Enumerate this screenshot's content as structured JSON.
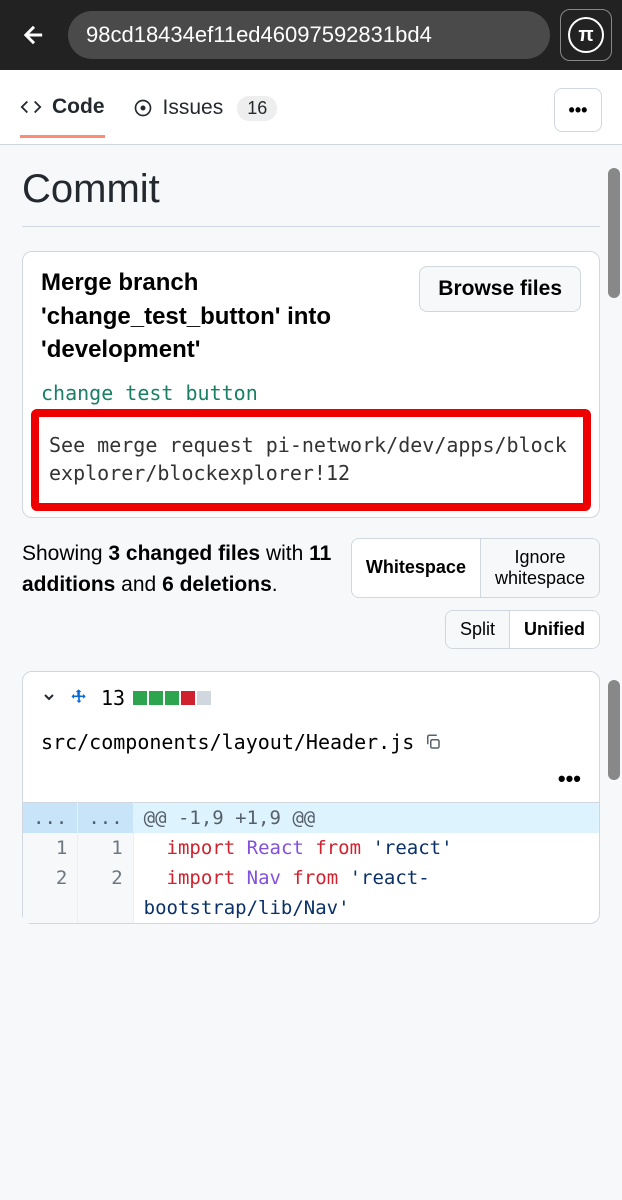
{
  "browser": {
    "url": "98cd18434ef11ed46097592831bd4",
    "pi_symbol": "π"
  },
  "tabs": {
    "code": "Code",
    "issues": "Issues",
    "issues_count": "16"
  },
  "page": {
    "title": "Commit"
  },
  "commit": {
    "title": "Merge branch 'change_test_button' into 'development'",
    "browse_btn": "Browse files",
    "description": "change test button",
    "merge_request": "See merge request pi-network/dev/apps/blockexplorer/blockexplorer!12"
  },
  "summary": {
    "prefix": "Showing ",
    "files": "3 changed files",
    "mid": " with ",
    "additions": "11 additions",
    "and": " and ",
    "deletions": "6 deletions",
    "suffix": "."
  },
  "controls": {
    "whitespace": "Whitespace",
    "ignore_whitespace": "Ignore whitespace",
    "split": "Split",
    "unified": "Unified"
  },
  "file": {
    "stat": "13",
    "path": "src/components/layout/Header.js",
    "hunk": "@@ -1,9 +1,9 @@",
    "ellipsis": "...",
    "rows": [
      {
        "ln_old": "1",
        "ln_new": "1",
        "kw": "import",
        "nm": " React ",
        "from": "from ",
        "str": "'react'"
      },
      {
        "ln_old": "2",
        "ln_new": "2",
        "kw": "import",
        "nm": " Nav ",
        "from": "from ",
        "str": "'react-"
      }
    ],
    "cutoff": "bootstrap/lib/Nav'"
  }
}
